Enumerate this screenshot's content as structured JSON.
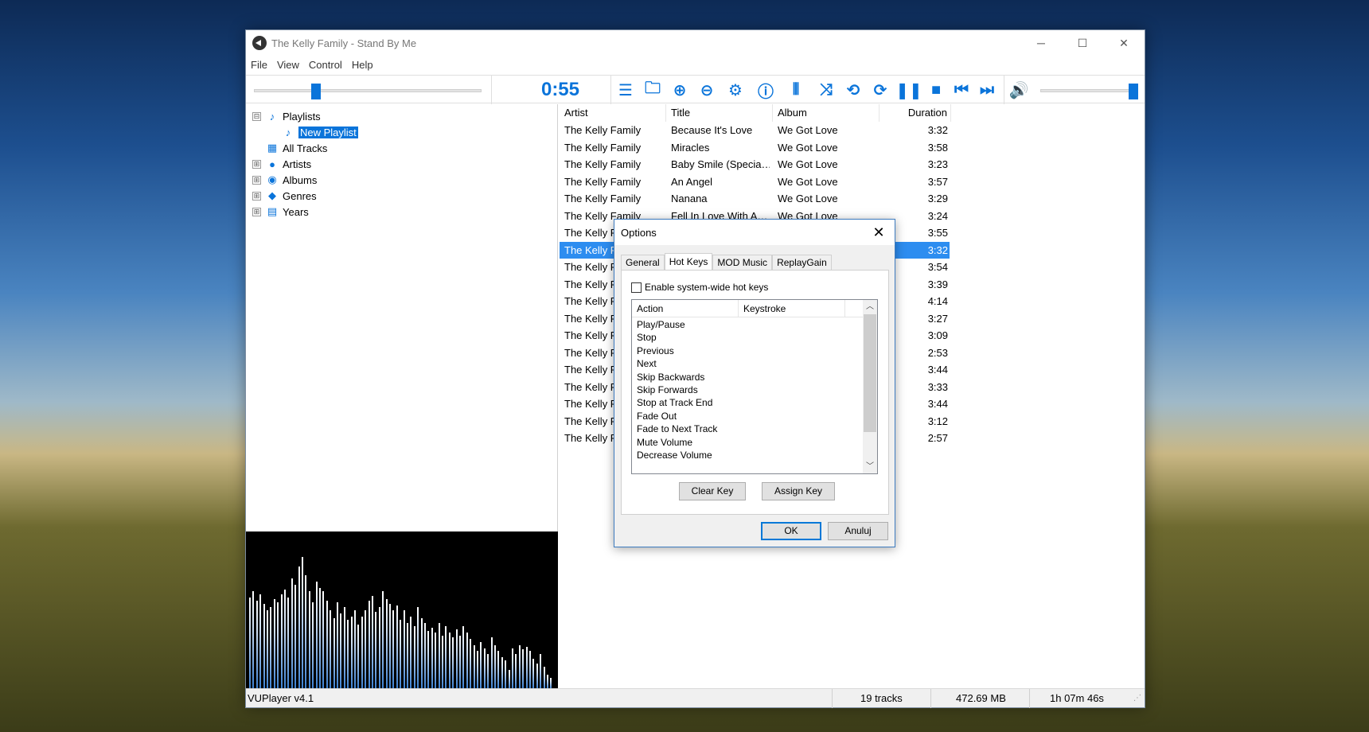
{
  "window": {
    "title": "The Kelly Family - Stand By Me",
    "controls": {
      "minimize": "─",
      "maximize": "☐",
      "close": "✕"
    }
  },
  "menu": [
    "File",
    "View",
    "Control",
    "Help"
  ],
  "toolbar": {
    "time": "0:55",
    "seek_progress": 0.26,
    "volume_level": 1.0,
    "icons": [
      "playlist-icon",
      "add-folder-icon",
      "add-icon",
      "remove-icon",
      "settings-icon",
      "info-icon",
      "eq-icon",
      "shuffle-icon",
      "repeat-track-icon",
      "repeat-all-icon",
      "pause-icon",
      "stop-icon",
      "previous-icon",
      "next-icon",
      "volume-icon"
    ]
  },
  "tree": {
    "items": [
      {
        "label": "Playlists",
        "expander": "⊟",
        "icon": "music-note-icon"
      },
      {
        "label": "New Playlist",
        "icon": "music-note-icon",
        "selected": true
      },
      {
        "label": "All Tracks",
        "icon": "tracks-icon"
      },
      {
        "label": "Artists",
        "expander": "⊞",
        "icon": "person-icon"
      },
      {
        "label": "Albums",
        "expander": "⊞",
        "icon": "disc-icon"
      },
      {
        "label": "Genres",
        "expander": "⊞",
        "icon": "genre-icon"
      },
      {
        "label": "Years",
        "expander": "⊞",
        "icon": "calendar-icon"
      }
    ]
  },
  "tracklist": {
    "columns": [
      "Artist",
      "Title",
      "Album",
      "Duration"
    ],
    "rows": [
      [
        "The Kelly Family",
        "Because It's Love",
        "We Got Love",
        "3:32"
      ],
      [
        "The Kelly Family",
        "Miracles",
        "We Got Love",
        "3:58"
      ],
      [
        "The Kelly Family",
        "Baby Smile (Specia…",
        "We Got Love",
        "3:23"
      ],
      [
        "The Kelly Family",
        "An Angel",
        "We Got Love",
        "3:57"
      ],
      [
        "The Kelly Family",
        "Nanana",
        "We Got Love",
        "3:29"
      ],
      [
        "The Kelly Family",
        "Fell In Love With A…",
        "We Got Love",
        "3:24"
      ],
      [
        "The Kelly F",
        "",
        "",
        "3:55"
      ],
      [
        "The Kelly F",
        "",
        "",
        "3:32"
      ],
      [
        "The Kelly F",
        "",
        "",
        "3:54"
      ],
      [
        "The Kelly F",
        "",
        "",
        "3:39"
      ],
      [
        "The Kelly F",
        "",
        "",
        "4:14"
      ],
      [
        "The Kelly F",
        "",
        "",
        "3:27"
      ],
      [
        "The Kelly F",
        "",
        "",
        "3:09"
      ],
      [
        "The Kelly F",
        "",
        "",
        "2:53"
      ],
      [
        "The Kelly F",
        "",
        "",
        "3:44"
      ],
      [
        "The Kelly F",
        "",
        "",
        "3:33"
      ],
      [
        "The Kelly F",
        "",
        "",
        "3:44"
      ],
      [
        "The Kelly F",
        "",
        "",
        "3:12"
      ],
      [
        "The Kelly F",
        "",
        "",
        "2:57"
      ]
    ],
    "selected_index": 7
  },
  "status": {
    "version": "VUPlayer v4.1",
    "tracks": "19 tracks",
    "size": "472.69 MB",
    "duration": "1h 07m 46s"
  },
  "visualizer": {
    "levels": [
      0.58,
      0.62,
      0.56,
      0.6,
      0.54,
      0.5,
      0.52,
      0.57,
      0.55,
      0.6,
      0.63,
      0.58,
      0.7,
      0.66,
      0.78,
      0.84,
      0.72,
      0.62,
      0.55,
      0.68,
      0.64,
      0.62,
      0.56,
      0.5,
      0.45,
      0.55,
      0.48,
      0.52,
      0.44,
      0.46,
      0.5,
      0.41,
      0.46,
      0.5,
      0.56,
      0.59,
      0.49,
      0.52,
      0.62,
      0.57,
      0.54,
      0.5,
      0.53,
      0.44,
      0.5,
      0.42,
      0.46,
      0.4,
      0.52,
      0.45,
      0.42,
      0.37,
      0.39,
      0.36,
      0.42,
      0.34,
      0.4,
      0.36,
      0.33,
      0.38,
      0.34,
      0.4,
      0.36,
      0.32,
      0.28,
      0.24,
      0.3,
      0.26,
      0.22,
      0.33,
      0.28,
      0.24,
      0.2,
      0.18,
      0.12,
      0.26,
      0.22,
      0.28,
      0.25,
      0.27,
      0.24,
      0.19,
      0.16,
      0.22,
      0.14,
      0.09,
      0.07
    ]
  },
  "dialog": {
    "title": "Options",
    "close": "✕",
    "tabs": [
      "General",
      "Hot Keys",
      "MOD Music",
      "ReplayGain"
    ],
    "active_tab": 1,
    "checkbox_label": "Enable system-wide hot keys",
    "checkbox_checked": false,
    "columns": [
      "Action",
      "Keystroke"
    ],
    "actions": [
      "Play/Pause",
      "Stop",
      "Previous",
      "Next",
      "Skip Backwards",
      "Skip Forwards",
      "Stop at Track End",
      "Fade Out",
      "Fade to Next Track",
      "Mute Volume",
      "Decrease Volume"
    ],
    "clear_key": "Clear Key",
    "assign_key": "Assign Key",
    "ok": "OK",
    "cancel": "Anuluj"
  },
  "colors": {
    "accent": "#0a74da",
    "selection": "#2d8df0"
  }
}
